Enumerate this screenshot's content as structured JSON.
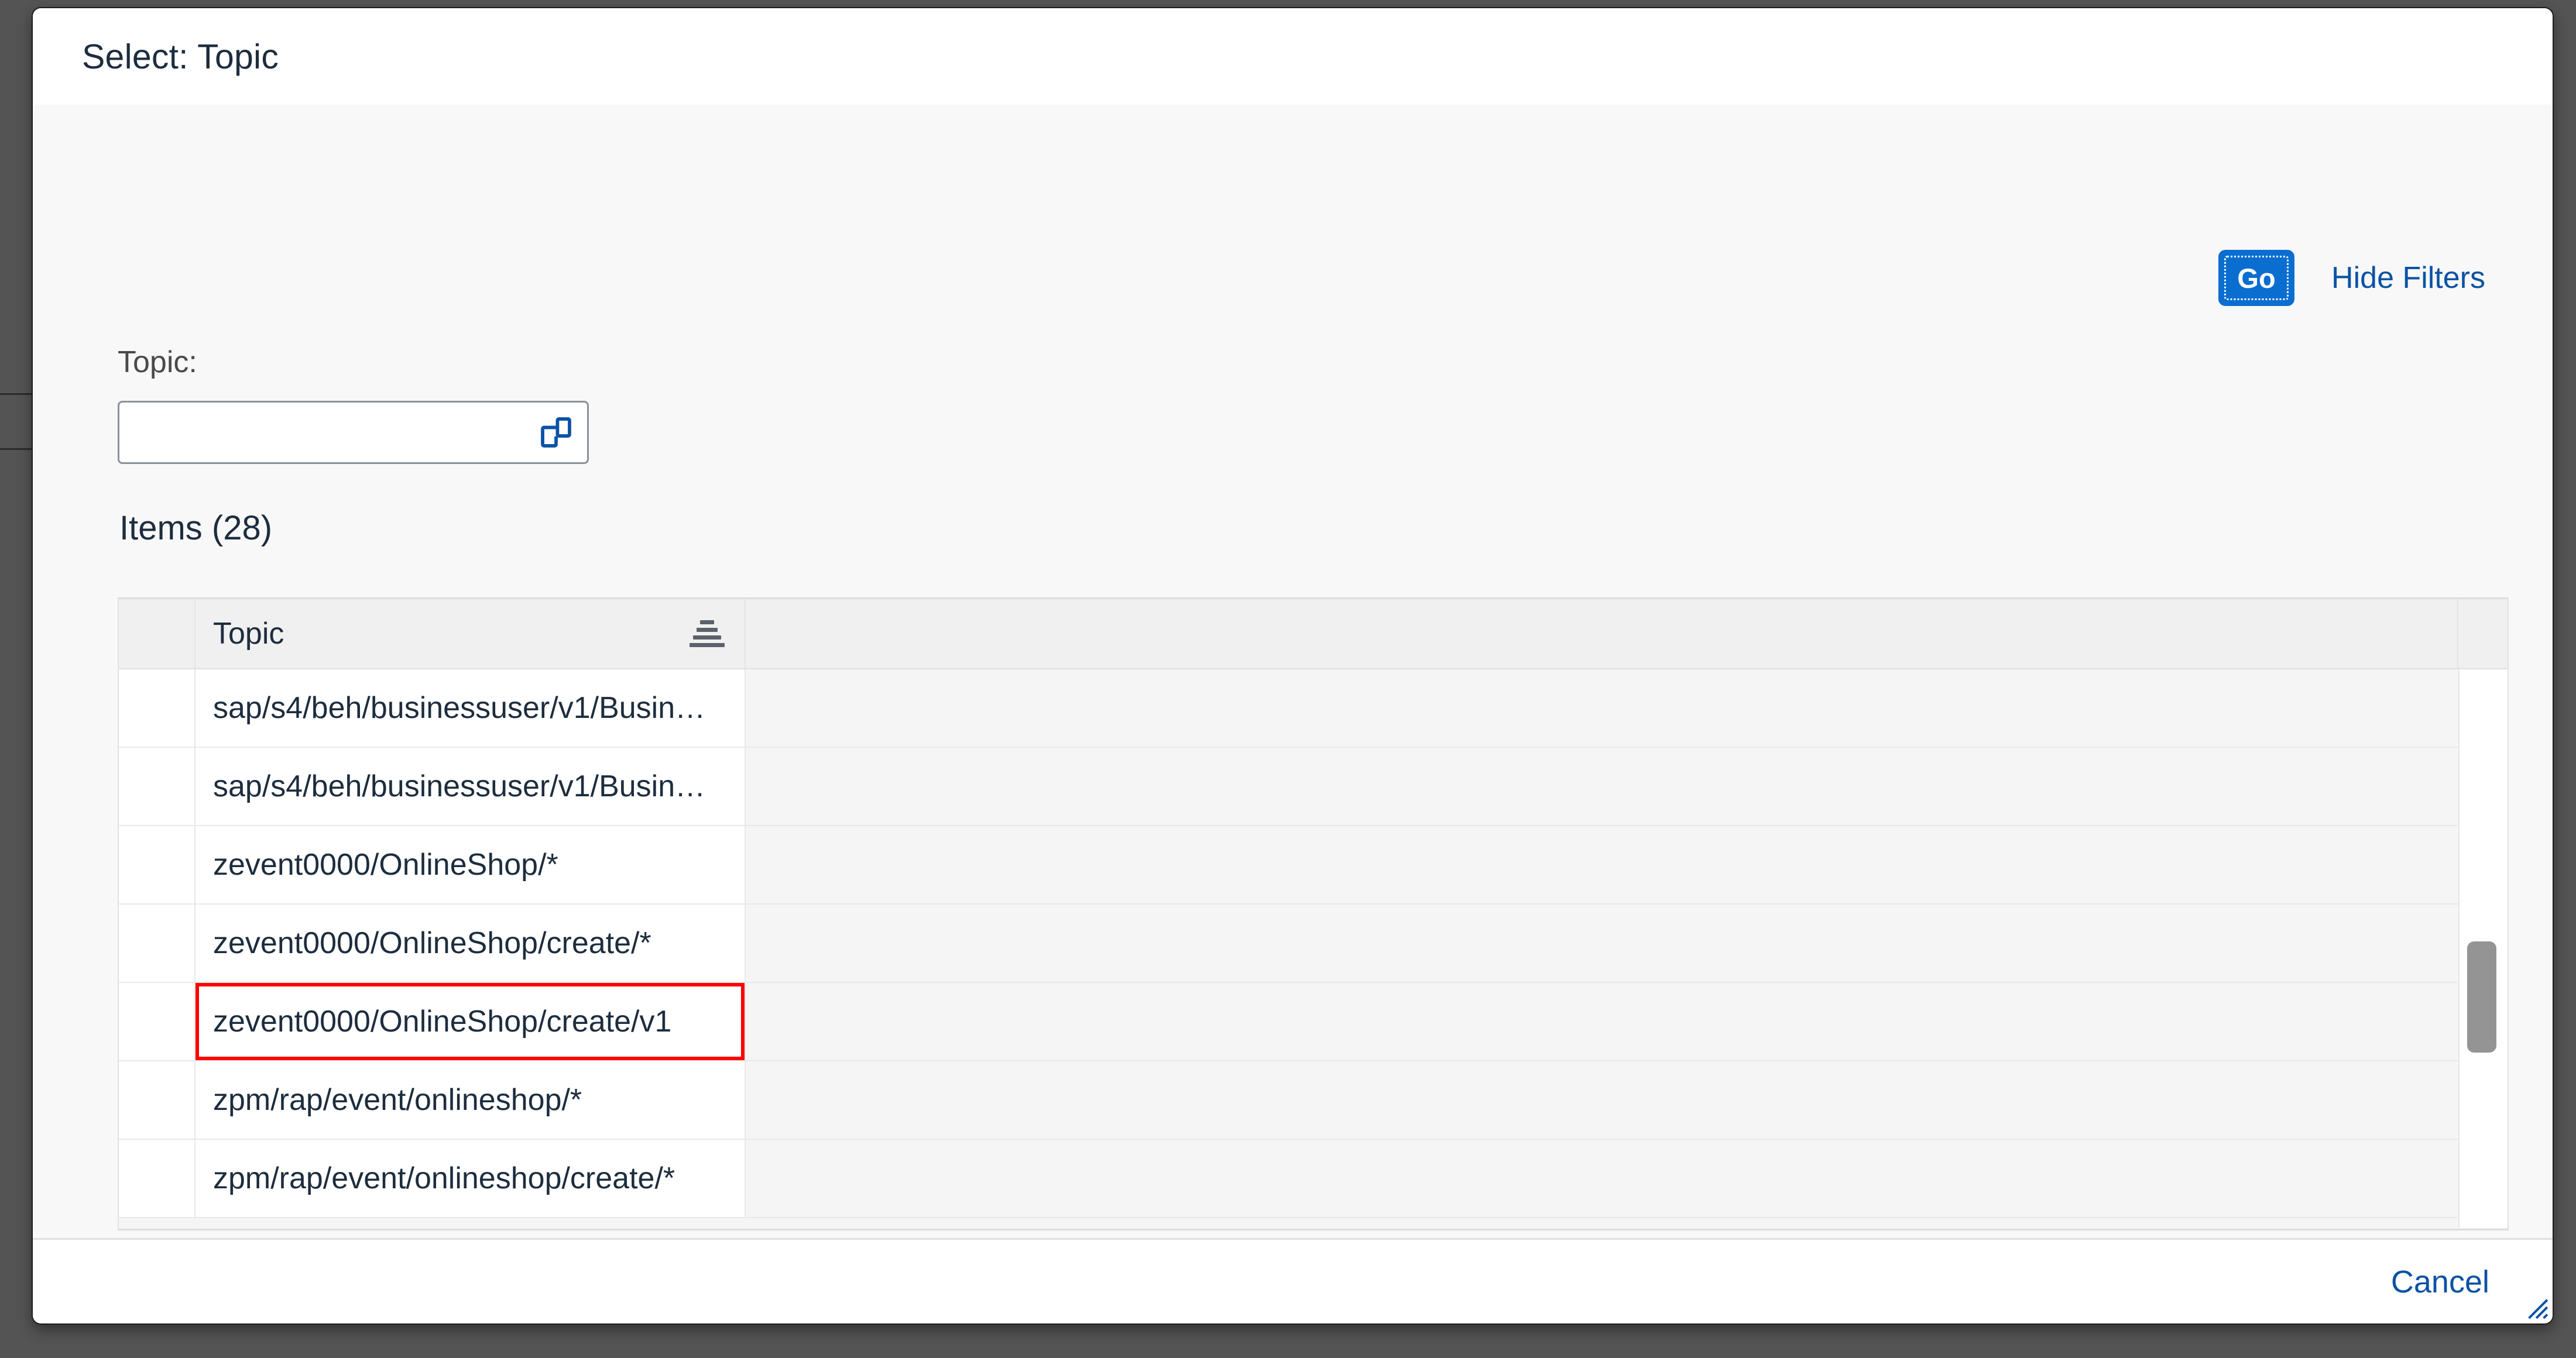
{
  "dialog": {
    "title": "Select: Topic"
  },
  "filterbar": {
    "go_label": "Go",
    "hide_filters_label": "Hide Filters",
    "topic_field": {
      "label": "Topic:",
      "value": "",
      "placeholder": ""
    }
  },
  "items": {
    "title": "Items (28)",
    "count": 28,
    "columns": [
      {
        "key": "select",
        "label": ""
      },
      {
        "key": "topic",
        "label": "Topic"
      }
    ],
    "rows": [
      {
        "topic": "sap/s4/beh/businessuser/v1/Busin…",
        "highlighted": false
      },
      {
        "topic": "sap/s4/beh/businessuser/v1/Busin…",
        "highlighted": false
      },
      {
        "topic": "zevent0000/OnlineShop/*",
        "highlighted": false
      },
      {
        "topic": "zevent0000/OnlineShop/create/*",
        "highlighted": false
      },
      {
        "topic": "zevent0000/OnlineShop/create/v1",
        "highlighted": true
      },
      {
        "topic": "zpm/rap/event/onlineshop/*",
        "highlighted": false
      },
      {
        "topic": "zpm/rap/event/onlineshop/create/*",
        "highlighted": false
      }
    ]
  },
  "footer": {
    "cancel_label": "Cancel"
  },
  "icons": {
    "value_help": "value-help-icon",
    "sort_filter": "sort-filter-icon",
    "resize_grip": "resize-grip-icon"
  },
  "colors": {
    "accent": "#0a6ed1",
    "link": "#0a52a4",
    "highlight": "#ff0000",
    "backdrop": "#545454",
    "text": "#1d2d3e"
  }
}
